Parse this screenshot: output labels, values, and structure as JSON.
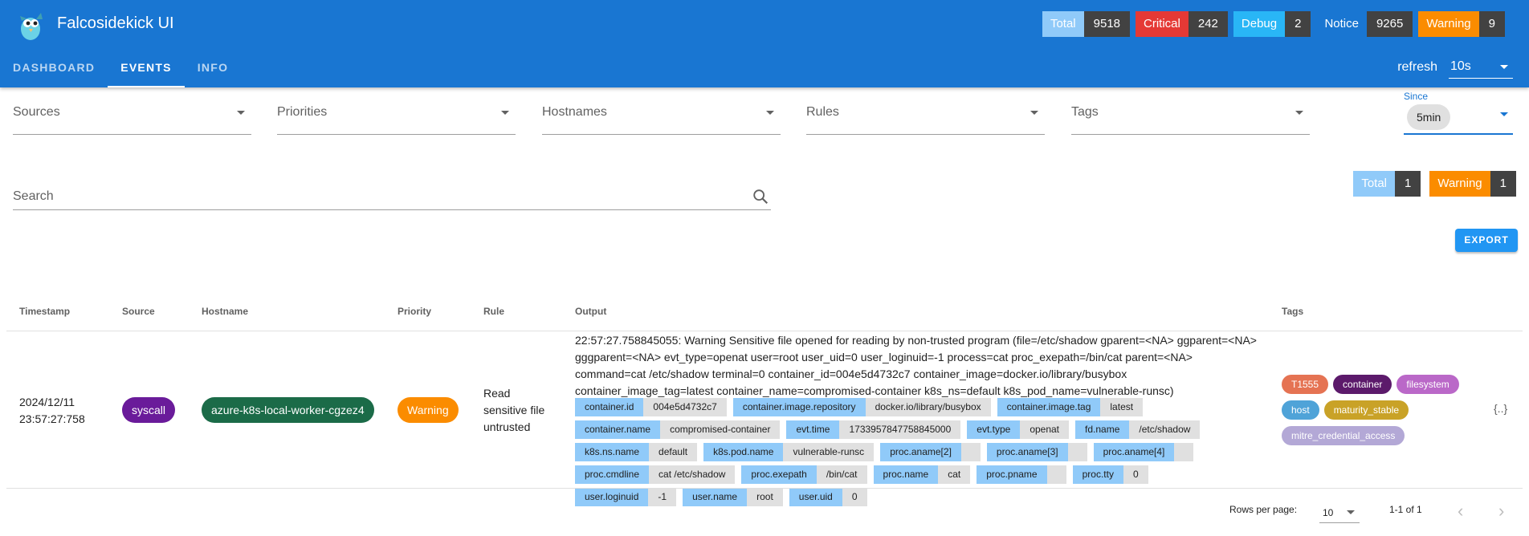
{
  "app": {
    "title": "Falcosidekick UI"
  },
  "header_counters": [
    {
      "label": "Total",
      "value": "9518",
      "color": "#90caf9"
    },
    {
      "label": "Critical",
      "value": "242",
      "color": "#e53935"
    },
    {
      "label": "Debug",
      "value": "2",
      "color": "#29b6f6"
    },
    {
      "label": "Notice",
      "value": "9265",
      "color": "#1976d2"
    },
    {
      "label": "Warning",
      "value": "9",
      "color": "#fb8c00"
    }
  ],
  "tabs": [
    {
      "label": "DASHBOARD",
      "active": false
    },
    {
      "label": "EVENTS",
      "active": true
    },
    {
      "label": "INFO",
      "active": false
    }
  ],
  "refresh": {
    "label": "refresh",
    "value": "10s"
  },
  "filters": {
    "sources": "Sources",
    "priorities": "Priorities",
    "hostnames": "Hostnames",
    "rules": "Rules",
    "tags": "Tags",
    "since_label": "Since",
    "since_value": "5min"
  },
  "search": {
    "placeholder": "Search"
  },
  "summary_counters": [
    {
      "label": "Total",
      "value": "1",
      "color": "#90caf9"
    },
    {
      "label": "Warning",
      "value": "1",
      "color": "#fb8c00"
    }
  ],
  "export_label": "EXPORT",
  "table": {
    "headers": {
      "timestamp": "Timestamp",
      "source": "Source",
      "hostname": "Hostname",
      "priority": "Priority",
      "rule": "Rule",
      "output": "Output",
      "tags": "Tags"
    },
    "row": {
      "timestamp_date": "2024/12/11",
      "timestamp_time": "23:57:27:758",
      "source": "syscall",
      "source_color": "#6a1b9a",
      "hostname": "azure-k8s-local-worker-cgzez4",
      "hostname_color": "#1b6b48",
      "priority": "Warning",
      "priority_color": "#fb8c00",
      "rule": "Read sensitive file untrusted",
      "output": "22:57:27.758845055: Warning Sensitive file opened for reading by non-trusted program (file=/etc/shadow gparent=<NA> ggparent=<NA> gggparent=<NA> evt_type=openat user=root user_uid=0 user_loginuid=-1 process=cat proc_exepath=/bin/cat parent=<NA> command=cat /etc/shadow terminal=0 container_id=004e5d4732c7 container_image=docker.io/library/busybox container_image_tag=latest container_name=compromised-container k8s_ns=default k8s_pod_name=vulnerable-runsc)",
      "fields": [
        {
          "k": "container.id",
          "v": "004e5d4732c7"
        },
        {
          "k": "container.image.repository",
          "v": "docker.io/library/busybox"
        },
        {
          "k": "container.image.tag",
          "v": "latest"
        },
        {
          "k": "container.name",
          "v": "compromised-container"
        },
        {
          "k": "evt.time",
          "v": "1733957847758845000"
        },
        {
          "k": "evt.type",
          "v": "openat"
        },
        {
          "k": "fd.name",
          "v": "/etc/shadow"
        },
        {
          "k": "k8s.ns.name",
          "v": "default"
        },
        {
          "k": "k8s.pod.name",
          "v": "vulnerable-runsc"
        },
        {
          "k": "proc.aname[2]",
          "v": ""
        },
        {
          "k": "proc.aname[3]",
          "v": ""
        },
        {
          "k": "proc.aname[4]",
          "v": ""
        },
        {
          "k": "proc.cmdline",
          "v": "cat /etc/shadow"
        },
        {
          "k": "proc.exepath",
          "v": "/bin/cat"
        },
        {
          "k": "proc.name",
          "v": "cat"
        },
        {
          "k": "proc.pname",
          "v": ""
        },
        {
          "k": "proc.tty",
          "v": "0"
        },
        {
          "k": "user.loginuid",
          "v": "-1"
        },
        {
          "k": "user.name",
          "v": "root"
        },
        {
          "k": "user.uid",
          "v": "0"
        }
      ],
      "tags": [
        {
          "label": "T1555",
          "color": "#e57353"
        },
        {
          "label": "container",
          "color": "#5c1a6b"
        },
        {
          "label": "filesystem",
          "color": "#ba68c8"
        },
        {
          "label": "host",
          "color": "#4fa3d8"
        },
        {
          "label": "maturity_stable",
          "color": "#c9a227"
        },
        {
          "label": "mitre_credential_access",
          "color": "#b3a8d6"
        }
      ],
      "json_label": "{..}"
    }
  },
  "footer": {
    "rows_per_page_label": "Rows per page:",
    "rows_per_page": "10",
    "range": "1-1 of 1"
  }
}
